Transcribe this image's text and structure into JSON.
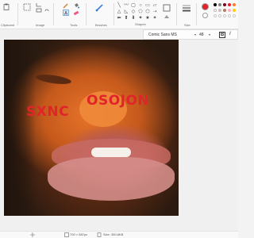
{
  "ribbon": {
    "groups": {
      "clipboard": "Clipboard",
      "image": "Image",
      "tools": "Tools",
      "brushes": "Brushes",
      "shapes": "Shapes",
      "size": "Size"
    },
    "shapes_glyphs": [
      "╲",
      "〰",
      "▢",
      "○",
      "▭",
      "▱",
      "△",
      "◺",
      "◇",
      "⬠",
      "⬡",
      "➝",
      "⬅",
      "⬆",
      "⬇",
      "✦",
      "★",
      "✶"
    ]
  },
  "colors": {
    "primary": "#e0242a",
    "palette_row1": [
      "#000000",
      "#7f7f7f",
      "#880015",
      "#ed1c24",
      "#ff7f27"
    ],
    "palette_row2": [
      "#ffffff",
      "#c3c3c3",
      "#b97a57",
      "#ffaec9",
      "#ffc90e"
    ]
  },
  "text_toolbar": {
    "font": "Comic Sans MS",
    "size": "48",
    "bold": "B",
    "italic": "I"
  },
  "canvas": {
    "text1": "SXNC",
    "text2": "OSOJON"
  },
  "status": {
    "dimensions": "700 × 587px",
    "size": "Size: 350.8KB"
  }
}
